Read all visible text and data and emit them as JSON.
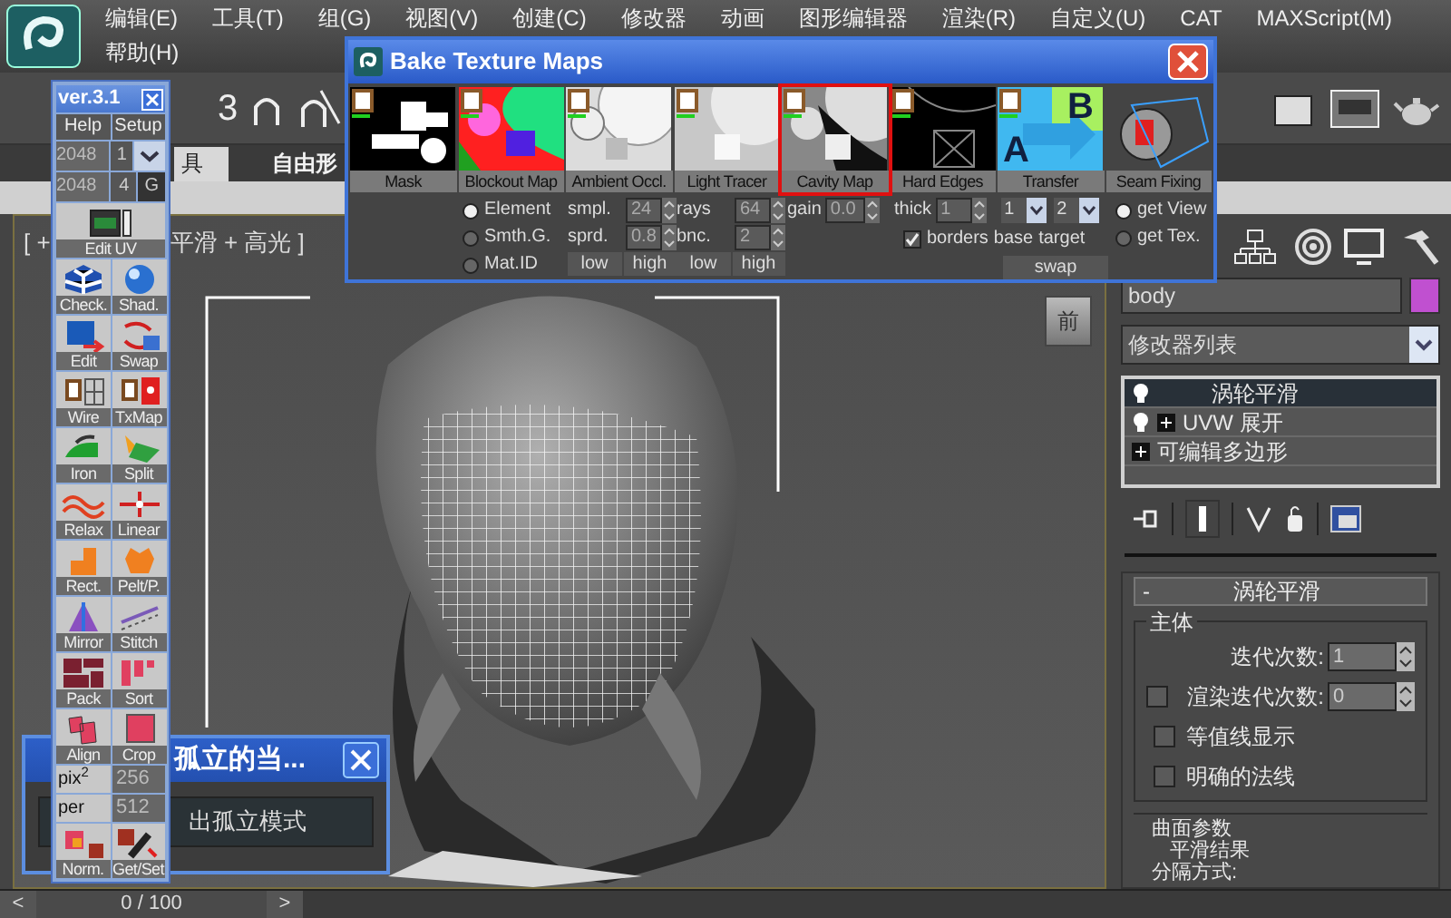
{
  "menu_bar": {
    "items": [
      "编辑(E)",
      "工具(T)",
      "组(G)",
      "视图(V)",
      "创建(C)",
      "修改器",
      "动画",
      "图形编辑器",
      "渲染(R)",
      "自定义(U)",
      "CAT",
      "MAXScript(M)",
      "帮助(H)"
    ]
  },
  "main_toolbar": {
    "snap_label": "3"
  },
  "ribbon_tabs": [
    {
      "label": "具",
      "selected": true
    },
    {
      "label": "自由形",
      "selected": false
    }
  ],
  "viewport": {
    "label_left": "[ +",
    "label_right": "平滑 + 高光 ]",
    "viewcube_label": "前"
  },
  "timeline": {
    "prev": "<",
    "position": "0 / 100",
    "next": ">",
    "level": 0
  },
  "command_panel": {
    "object_name": "body",
    "modifier_list": "修改器列表",
    "stack": [
      {
        "label": "涡轮平滑",
        "selected": true,
        "bulb": true,
        "expandable": false
      },
      {
        "label": "UVW 展开",
        "selected": false,
        "bulb": true,
        "expandable": true
      },
      {
        "label": "可编辑多边形",
        "selected": false,
        "bulb": false,
        "expandable": true
      }
    ],
    "rollout": {
      "collapse": "-",
      "title": "涡轮平滑",
      "group": "主体",
      "iterations_label": "迭代次数:",
      "iterations": "1",
      "render_iterations": {
        "label": "渲染迭代次数:",
        "checked": false,
        "value": "0"
      },
      "checkboxes": [
        {
          "label": "等值线显示",
          "checked": false
        },
        {
          "label": "明确的法线",
          "checked": false
        }
      ],
      "surface_group": "曲面参数",
      "smooth_result": "平滑结果",
      "separate_by": "分隔方式:"
    }
  },
  "bake_window": {
    "title": "Bake Texture Maps",
    "maps": [
      {
        "label": "Mask",
        "selected": false
      },
      {
        "label": "Blockout Map",
        "selected": false
      },
      {
        "label": "Ambient Occl.",
        "selected": false
      },
      {
        "label": "Light Tracer",
        "selected": false
      },
      {
        "label": "Cavity Map",
        "selected": true
      },
      {
        "label": "Hard Edges",
        "selected": false
      },
      {
        "label": "Transfer",
        "selected": false,
        "image_text": [
          "A",
          "B"
        ]
      },
      {
        "label": "Seam Fixing",
        "selected": false
      }
    ],
    "element_options": [
      {
        "label": "Element",
        "selected": true
      },
      {
        "label": "Smth.G.",
        "selected": false
      },
      {
        "label": "Mat.ID",
        "selected": false
      }
    ],
    "ambient": {
      "samples_label": "smpl.",
      "samples": "24",
      "spread_label": "sprd.",
      "spread": "0.8",
      "low": "low",
      "high": "high"
    },
    "light_tracer": {
      "rays_label": "rays",
      "rays": "64",
      "bounce_label": "bnc.",
      "bounce": "2",
      "low": "low",
      "high": "high"
    },
    "cavity": {
      "gain_label": "gain",
      "gain": "0.0"
    },
    "hard_edges": {
      "thick_label": "thick",
      "thick": "1",
      "borders": {
        "label": "borders",
        "checked": true
      }
    },
    "transfer": {
      "base": "1",
      "target": "2",
      "base_label": "base",
      "target_label": "target",
      "swap": "swap"
    },
    "seam": [
      {
        "label": "get View",
        "selected": true
      },
      {
        "label": "get Tex.",
        "selected": false
      }
    ]
  },
  "uv_toolbar": {
    "title": "ver.3.1",
    "menu": [
      "Help",
      "Setup"
    ],
    "size_rows": [
      {
        "value": "2048",
        "option": "1",
        "kind": "dropdown"
      },
      {
        "value": "2048",
        "option": "4",
        "extra": "G",
        "kind": "buttons"
      }
    ],
    "edit_uv": "Edit UV",
    "tools": [
      "Check.",
      "Shad.",
      "Edit",
      "Swap",
      "Wire",
      "TxMap",
      "Iron",
      "Split",
      "Relax",
      "Linear",
      "Rect.",
      "Pelt/P.",
      "Mirror",
      "Stitch",
      "Pack",
      "Sort",
      "Align",
      "Crop"
    ],
    "pixel_rows": [
      {
        "label": "pix$^{2}$",
        "value": "256"
      },
      {
        "label": "per",
        "value": "512"
      }
    ],
    "bottom_tools": [
      "Norm.",
      "Get/Set"
    ]
  },
  "isolate_window": {
    "title": "孤立的当...",
    "button": "出孤立模式"
  }
}
